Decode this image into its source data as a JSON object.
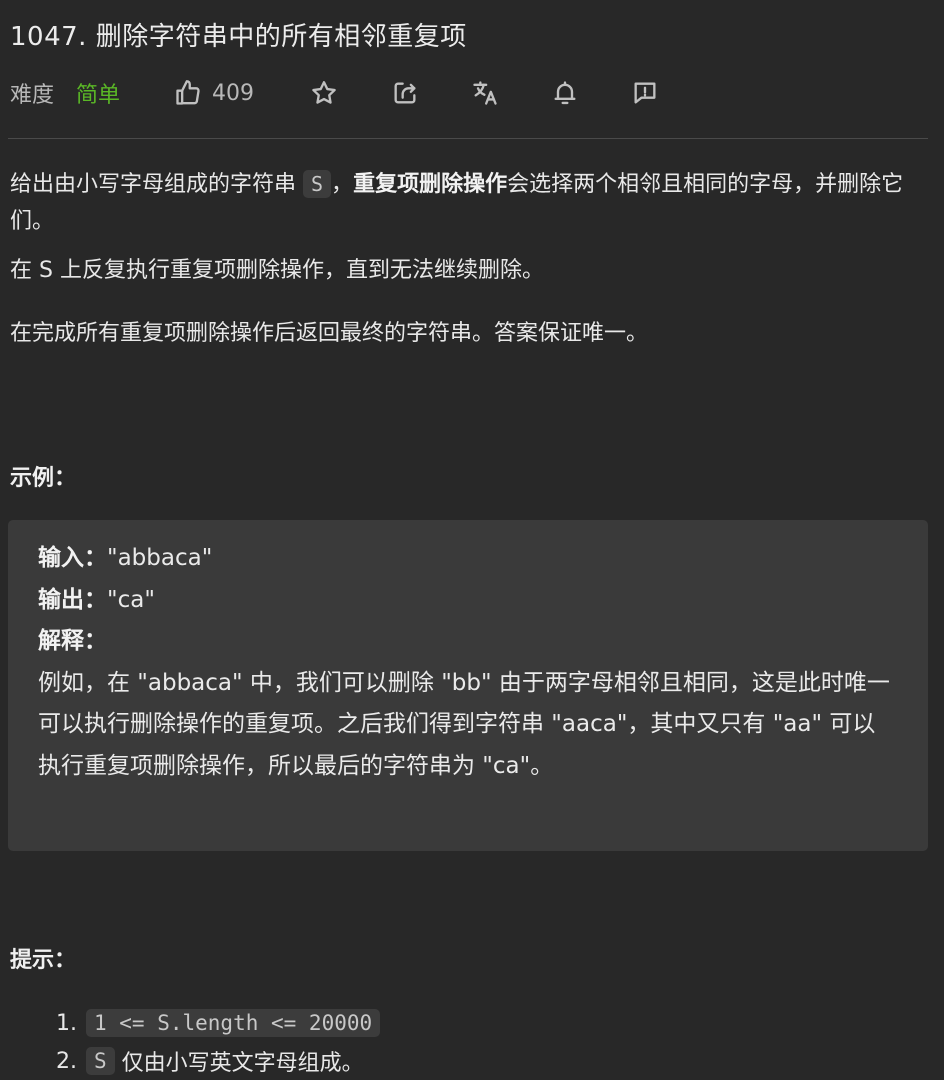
{
  "problem": {
    "title": "1047. 删除字符串中的所有相邻重复项"
  },
  "meta": {
    "difficulty_label": "难度",
    "difficulty_value": "简单",
    "likes": "409",
    "icons": [
      "thumbs-up-icon",
      "star-icon",
      "share-icon",
      "translate-icon",
      "bell-icon",
      "feedback-icon"
    ],
    "colors": {
      "difficulty_easy": "#5ab726",
      "background": "#282828",
      "code_block_bg": "#3a3a3a"
    }
  },
  "description": {
    "p1_prefix": "给出由小写字母组成的字符串 ",
    "p1_code": "S",
    "p1_mid": "，",
    "p1_bold": "重复项删除操作",
    "p1_suffix": "会选择两个相邻且相同的字母，并删除它们。",
    "p2": "在 S 上反复执行重复项删除操作，直到无法继续删除。",
    "p3": "在完成所有重复项删除操作后返回最终的字符串。答案保证唯一。"
  },
  "example": {
    "heading": "示例：",
    "input_label": "输入：",
    "input_value": "\"abbaca\"",
    "output_label": "输出：",
    "output_value": "\"ca\"",
    "explain_label": "解释：",
    "explanation": "例如，在 \"abbaca\" 中，我们可以删除 \"bb\" 由于两字母相邻且相同，这是此时唯一可以执行删除操作的重复项。之后我们得到字符串 \"aaca\"，其中又只有 \"aa\" 可以执行重复项删除操作，所以最后的字符串为 \"ca\"。"
  },
  "hints": {
    "heading": "提示：",
    "items": [
      {
        "num": "1.",
        "code": "1 <= S.length <= 20000",
        "text": ""
      },
      {
        "num": "2.",
        "code": "S",
        "text": " 仅由小写英文字母组成。"
      }
    ]
  }
}
